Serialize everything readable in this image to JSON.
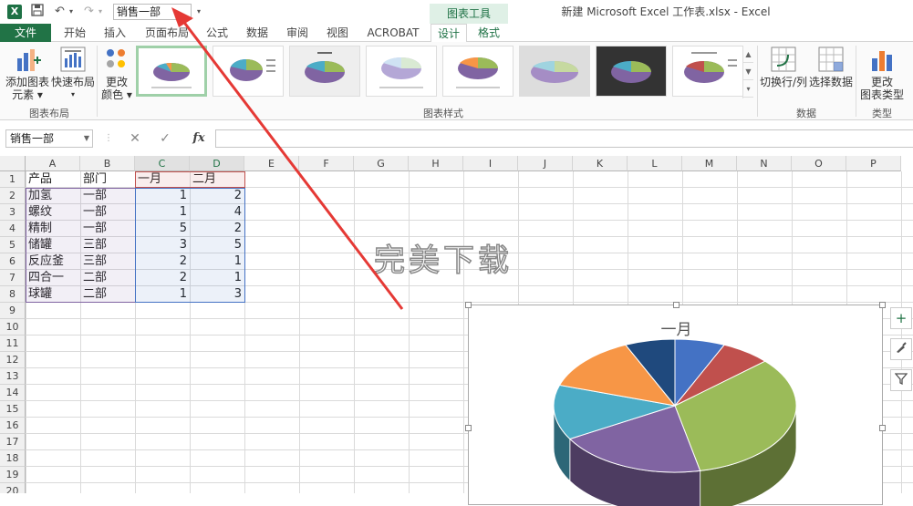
{
  "title_bar": {
    "app_logo": "X",
    "name_display": "销售一部",
    "contextual_group": "图表工具",
    "window_title": "新建 Microsoft Excel 工作表.xlsx - Excel",
    "icons": [
      "save-icon",
      "undo-icon",
      "redo-icon",
      "customize-qat-icon"
    ]
  },
  "tabs": [
    "文件",
    "开始",
    "插入",
    "页面布局",
    "公式",
    "数据",
    "审阅",
    "视图",
    "ACROBAT",
    "设计",
    "格式"
  ],
  "ribbon": {
    "add_element_1": "添加图表",
    "add_element_2": "元素",
    "quick_layout": "快速布局",
    "change_colors_1": "更改",
    "change_colors_2": "颜色",
    "group_layout": "图表布局",
    "group_styles": "图表样式",
    "switch_row_col": "切换行/列",
    "select_data": "选择数据",
    "group_data": "数据",
    "change_type_1": "更改",
    "change_type_2": "图表类型",
    "group_type": "类型"
  },
  "formula_bar": {
    "name_box": "销售一部",
    "cancel": "✕",
    "enter": "✓",
    "fx": "fx",
    "value": ""
  },
  "columns": [
    "A",
    "B",
    "C",
    "D",
    "E",
    "F",
    "G",
    "H",
    "I",
    "J",
    "K",
    "L",
    "M",
    "N",
    "O",
    "P"
  ],
  "rows": [
    "1",
    "2",
    "3",
    "4",
    "5",
    "6",
    "7",
    "8",
    "9",
    "10",
    "11",
    "12",
    "13",
    "14",
    "15",
    "16",
    "17",
    "18",
    "19",
    "20"
  ],
  "table": {
    "headers": [
      "产品",
      "部门",
      "一月",
      "二月"
    ],
    "data": [
      [
        "加氢",
        "一部",
        "1",
        "2"
      ],
      [
        "螺纹",
        "一部",
        "1",
        "4"
      ],
      [
        "精制",
        "一部",
        "5",
        "2"
      ],
      [
        "储罐",
        "三部",
        "3",
        "5"
      ],
      [
        "反应釜",
        "三部",
        "2",
        "1"
      ],
      [
        "四合一",
        "二部",
        "2",
        "1"
      ],
      [
        "球罐",
        "二部",
        "1",
        "3"
      ]
    ]
  },
  "watermark": "完美下载",
  "chart": {
    "title": "一月",
    "side_buttons": [
      "chart-elements-icon",
      "chart-styles-icon",
      "chart-filters-icon"
    ]
  },
  "chart_data": {
    "type": "pie",
    "title": "一月",
    "categories": [
      "加氢",
      "螺纹",
      "精制",
      "储罐",
      "反应釜",
      "四合一",
      "球罐"
    ],
    "values": [
      1,
      1,
      5,
      3,
      2,
      2,
      1
    ],
    "colors": [
      "#4472c4",
      "#c0504d",
      "#9bbb59",
      "#8064a2",
      "#4bacc6",
      "#f79646",
      "#1f497d"
    ]
  }
}
